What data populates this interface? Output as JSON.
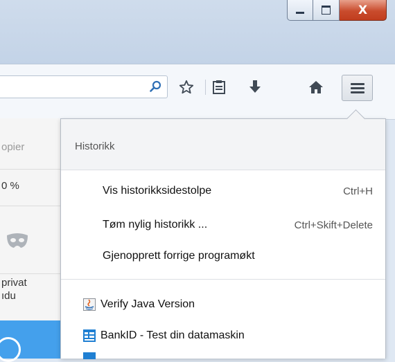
{
  "window": {
    "minimize_icon": "minimize-icon",
    "maximize_icon": "maximize-icon",
    "close_glyph": "X"
  },
  "toolbar": {
    "icons": [
      "search-icon",
      "star-icon",
      "reading-list-icon",
      "download-icon",
      "home-icon",
      "hamburger-menu-icon"
    ]
  },
  "left_panel": {
    "copy_label": "opier",
    "zoom_label": "0 %",
    "private_line1": "privat",
    "private_line2": "ıdu"
  },
  "history_panel": {
    "title": "Historikk",
    "items": [
      {
        "label": "Vis historikksidestolpe",
        "shortcut": "Ctrl+H"
      },
      {
        "label": "Tøm nylig historikk ...",
        "shortcut": "Ctrl+Skift+Delete"
      },
      {
        "label": "Gjenopprett forrige programøkt",
        "shortcut": ""
      }
    ],
    "bookmarks": [
      {
        "label": "Verify Java Version",
        "icon": "java-icon"
      },
      {
        "label": "BankID - Test din datamaskin",
        "icon": "bankid-icon"
      }
    ]
  },
  "colors": {
    "accent_blue": "#44a0ec",
    "close_red": "#c94c2d"
  }
}
